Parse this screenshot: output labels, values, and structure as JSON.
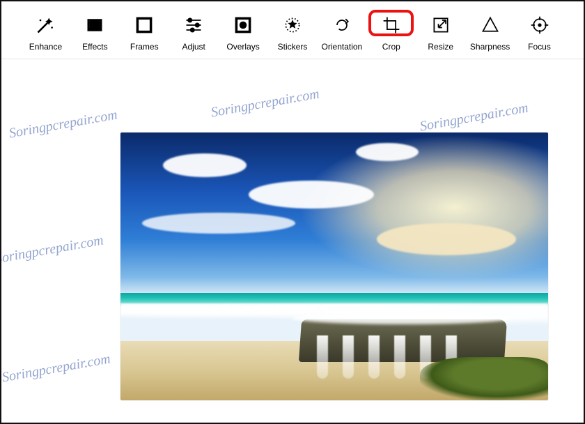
{
  "toolbar": {
    "items": [
      {
        "id": "enhance",
        "label": "Enhance",
        "icon": "enhance-icon"
      },
      {
        "id": "effects",
        "label": "Effects",
        "icon": "effects-icon"
      },
      {
        "id": "frames",
        "label": "Frames",
        "icon": "frames-icon"
      },
      {
        "id": "adjust",
        "label": "Adjust",
        "icon": "adjust-icon"
      },
      {
        "id": "overlays",
        "label": "Overlays",
        "icon": "overlays-icon"
      },
      {
        "id": "stickers",
        "label": "Stickers",
        "icon": "stickers-icon"
      },
      {
        "id": "orientation",
        "label": "Orientation",
        "icon": "orientation-icon"
      },
      {
        "id": "crop",
        "label": "Crop",
        "icon": "crop-icon",
        "highlighted": true
      },
      {
        "id": "resize",
        "label": "Resize",
        "icon": "resize-icon"
      },
      {
        "id": "sharpness",
        "label": "Sharpness",
        "icon": "sharpness-icon"
      },
      {
        "id": "focus",
        "label": "Focus",
        "icon": "focus-icon"
      }
    ]
  },
  "canvas": {
    "image_description": "Long-exposure seascape: deep blue sky with white and golden clouds, turquoise ocean, white surf flowing over a dark mossy rock ledge like small waterfalls onto a sandy beach.",
    "watermark_text": "Soringpcrepair.com"
  }
}
